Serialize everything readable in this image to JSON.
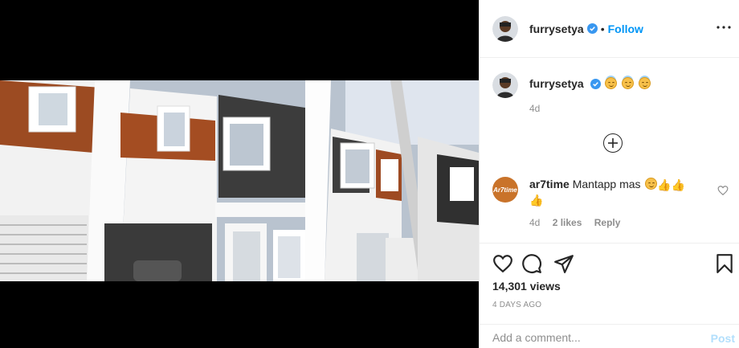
{
  "colors": {
    "accent": "#0095f6",
    "muted": "#8e8e8e",
    "post_disabled": "#b2dffc"
  },
  "header": {
    "username": "furrysetya",
    "separator": "•",
    "follow_label": "Follow"
  },
  "caption": {
    "username": "furrysetya",
    "emoji": [
      "smiling-face-with-halo",
      "smiling-face-with-halo",
      "smiling-face-with-halo"
    ],
    "time": "4d"
  },
  "comment": {
    "username": "ar7time",
    "avatar_text": "Ar7time",
    "text": "Mantapp mas",
    "emoji": [
      "smiling-face-with-smiling-eyes",
      "thumbs-up",
      "thumbs-up",
      "thumbs-up"
    ],
    "time": "4d",
    "likes": "2 likes",
    "reply_label": "Reply"
  },
  "actions": {
    "icons": [
      "heart-icon",
      "comment-icon",
      "share-icon",
      "bookmark-icon"
    ]
  },
  "views": "14,301 views",
  "posted": "4 DAYS AGO",
  "add_comment": {
    "placeholder": "Add a comment...",
    "post_label": "Post"
  }
}
